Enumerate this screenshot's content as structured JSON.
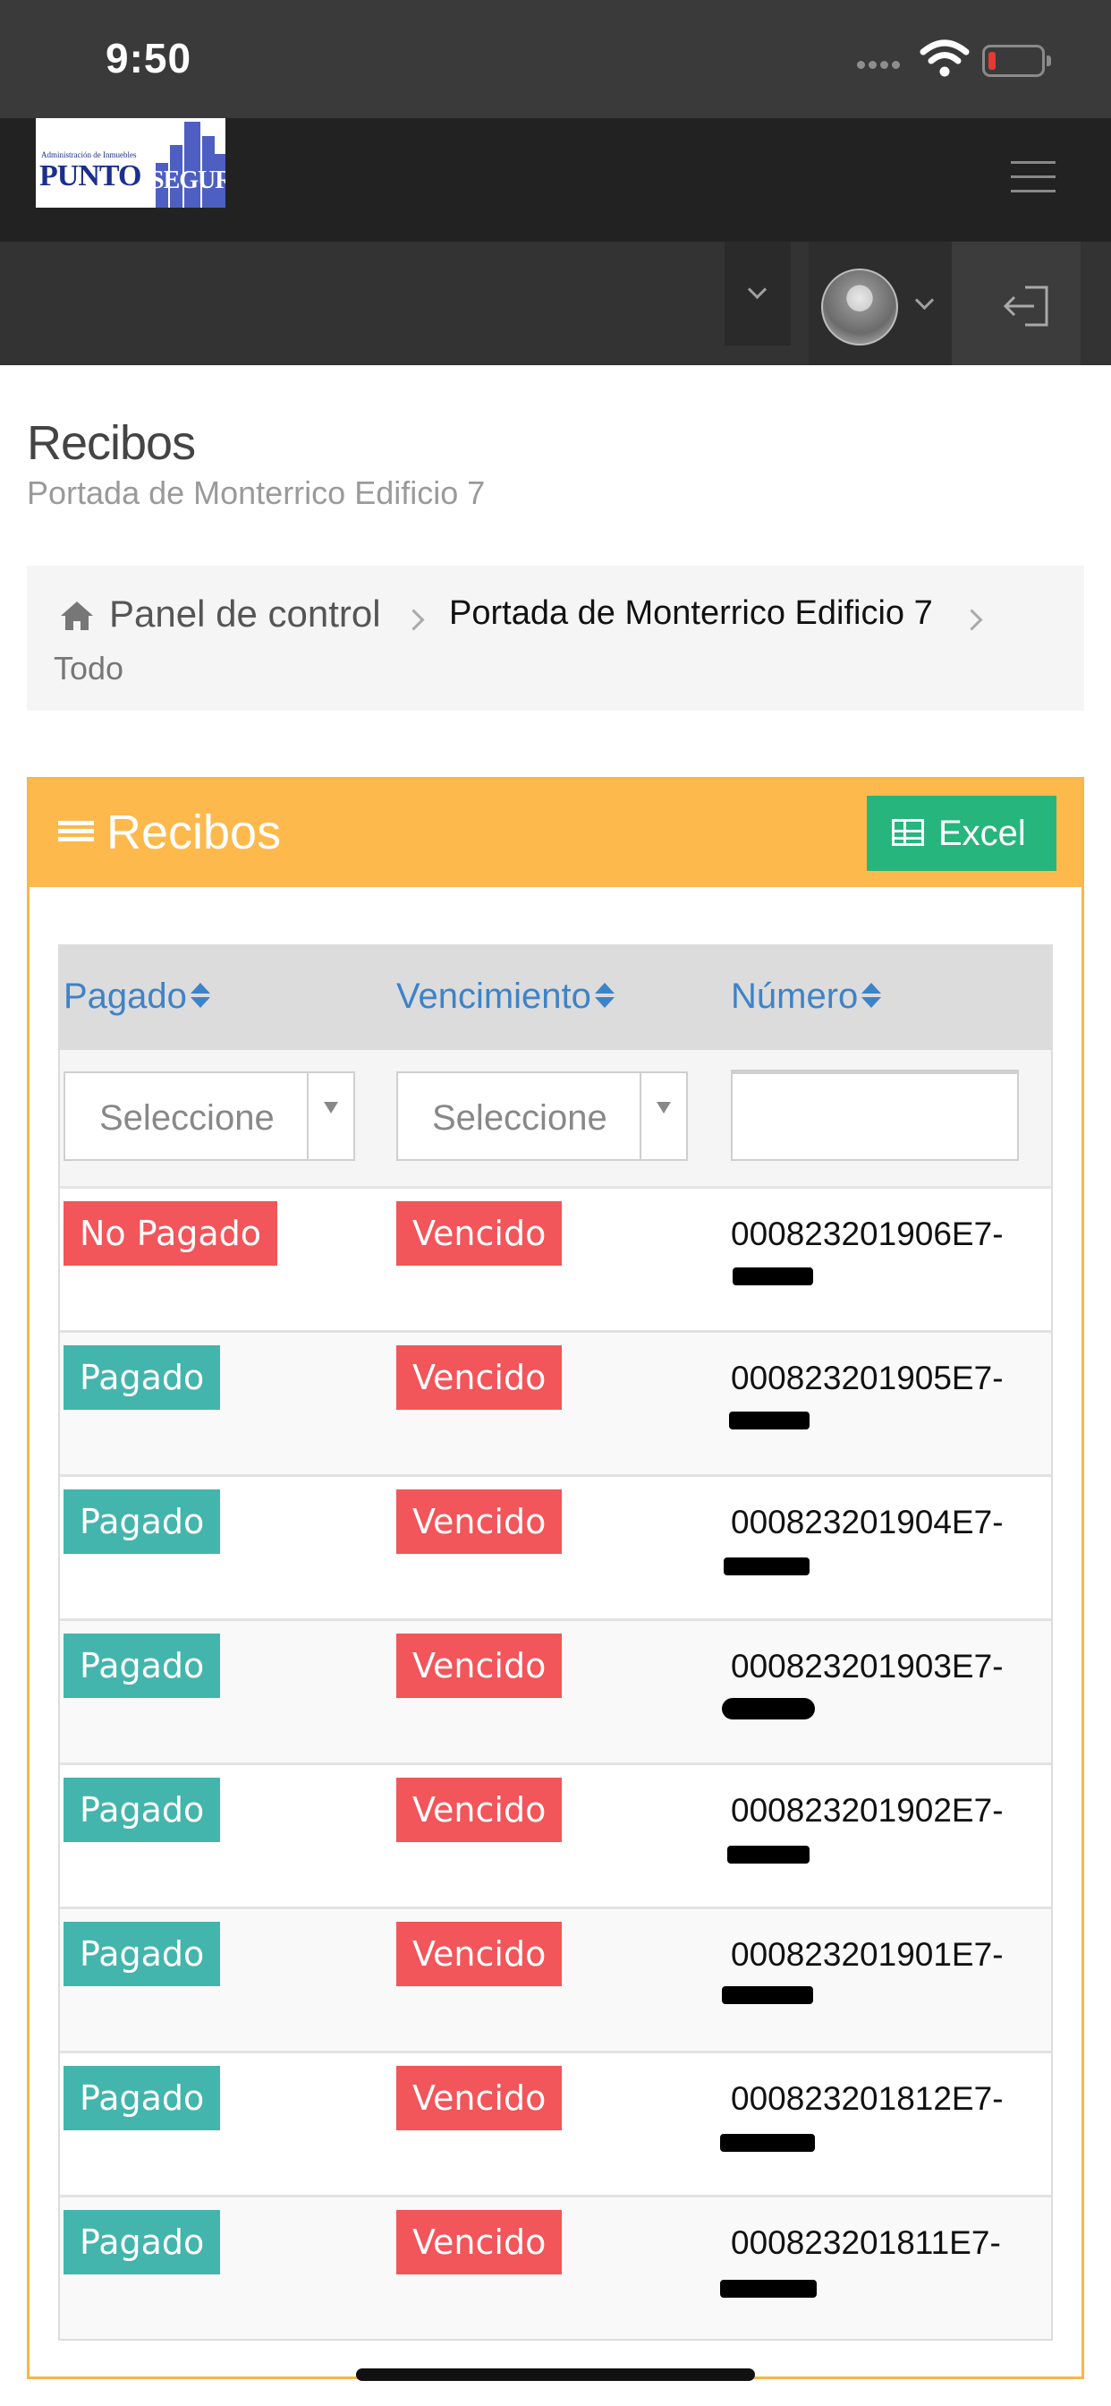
{
  "status_bar": {
    "time": "9:50"
  },
  "brand": {
    "logo_line1": "Administración de Inmuebles",
    "logo_part1": "PUNTO",
    "logo_part2": "SEGUR"
  },
  "page": {
    "title": "Recibos",
    "subtitle": "Portada de Monterrico Edificio 7"
  },
  "breadcrumb": {
    "items": [
      "Panel de control",
      "Portada de Monterrico Edificio 7",
      "Todo"
    ]
  },
  "panel": {
    "title": "Recibos",
    "excel_label": "Excel"
  },
  "table": {
    "columns": [
      "Pagado",
      "Vencimiento",
      "Número"
    ],
    "filters": {
      "pagado_placeholder": "Seleccione",
      "vencimiento_placeholder": "Seleccione",
      "numero_value": ""
    },
    "rows": [
      {
        "pagado": "No Pagado",
        "vencimiento": "Vencido",
        "numero": "000823201906E7-"
      },
      {
        "pagado": "Pagado",
        "vencimiento": "Vencido",
        "numero": "000823201905E7-"
      },
      {
        "pagado": "Pagado",
        "vencimiento": "Vencido",
        "numero": "000823201904E7-"
      },
      {
        "pagado": "Pagado",
        "vencimiento": "Vencido",
        "numero": "000823201903E7-"
      },
      {
        "pagado": "Pagado",
        "vencimiento": "Vencido",
        "numero": "000823201902E7-"
      },
      {
        "pagado": "Pagado",
        "vencimiento": "Vencido",
        "numero": "000823201901E7-"
      },
      {
        "pagado": "Pagado",
        "vencimiento": "Vencido",
        "numero": "000823201812E7-"
      },
      {
        "pagado": "Pagado",
        "vencimiento": "Vencido",
        "numero": "000823201811E7-"
      }
    ]
  },
  "icons": [
    "home-icon",
    "list-icon",
    "table-icon",
    "menu-icon",
    "logout-icon",
    "chevron-down-icon",
    "avatar"
  ],
  "colors": {
    "panel_header": "#fdb94b",
    "excel": "#26b57d",
    "pagado": "#43b5ac",
    "vencido": "#f2555a",
    "link": "#3d83c8"
  }
}
